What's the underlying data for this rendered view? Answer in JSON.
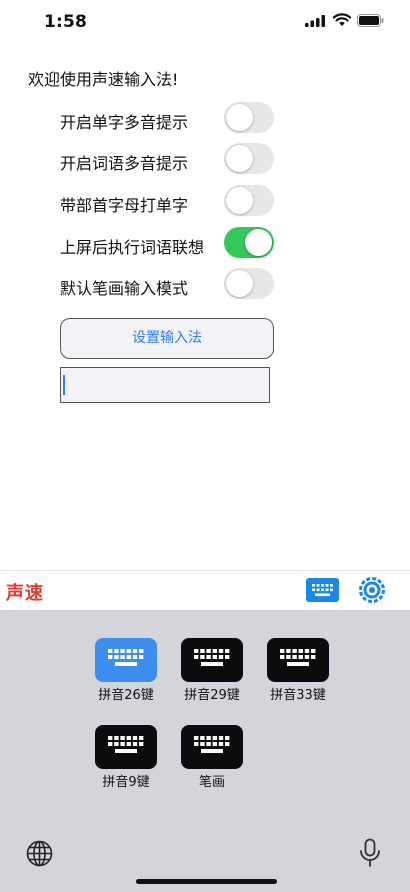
{
  "status_bar": {
    "time": "1:58"
  },
  "settings": {
    "welcome": "欢迎使用声速输入法!",
    "toggles": [
      {
        "label": "开启单字多音提示",
        "on": false
      },
      {
        "label": "开启词语多音提示",
        "on": false
      },
      {
        "label": "带部首字母打单字",
        "on": false
      },
      {
        "label": "上屏后执行词语联想",
        "on": true
      },
      {
        "label": "默认笔画输入模式",
        "on": false
      }
    ],
    "setup_button": "设置输入法",
    "input_value": ""
  },
  "keyboard": {
    "brand": "声速",
    "layouts": [
      {
        "label": "拼音26键",
        "selected": true
      },
      {
        "label": "拼音29键",
        "selected": false
      },
      {
        "label": "拼音33键",
        "selected": false
      },
      {
        "label": "拼音9键",
        "selected": false
      },
      {
        "label": "笔画",
        "selected": false
      }
    ]
  },
  "colors": {
    "accent": "#2f7cf6",
    "toggle_on": "#34c759",
    "brand": "#e23a2e",
    "selected_layout": "#3e8ef0"
  }
}
